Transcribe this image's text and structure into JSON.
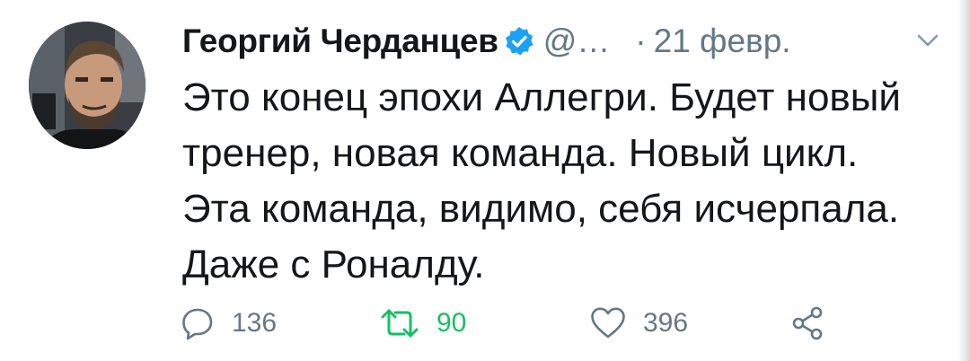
{
  "tweet": {
    "author_name": "Георгий Черданцев",
    "handle": "@…",
    "separator": "·",
    "date": "21 февр.",
    "text_lines": [
      "Это конец эпохи Аллегри. Будет новый",
      "тренер, новая команда. Новый цикл.",
      "Эта команда, видимо, себя исчерпала.",
      "Даже с Роналду."
    ],
    "verified": true
  },
  "actions": {
    "reply": {
      "icon": "reply-icon",
      "count": "136"
    },
    "retweet": {
      "icon": "retweet-icon",
      "count": "90"
    },
    "like": {
      "icon": "heart-icon",
      "count": "396"
    },
    "share": {
      "icon": "share-icon"
    }
  },
  "colors": {
    "text": "#14171a",
    "secondary": "#657786",
    "verified": "#1da1f2",
    "retweet_active": "#17bf63"
  }
}
